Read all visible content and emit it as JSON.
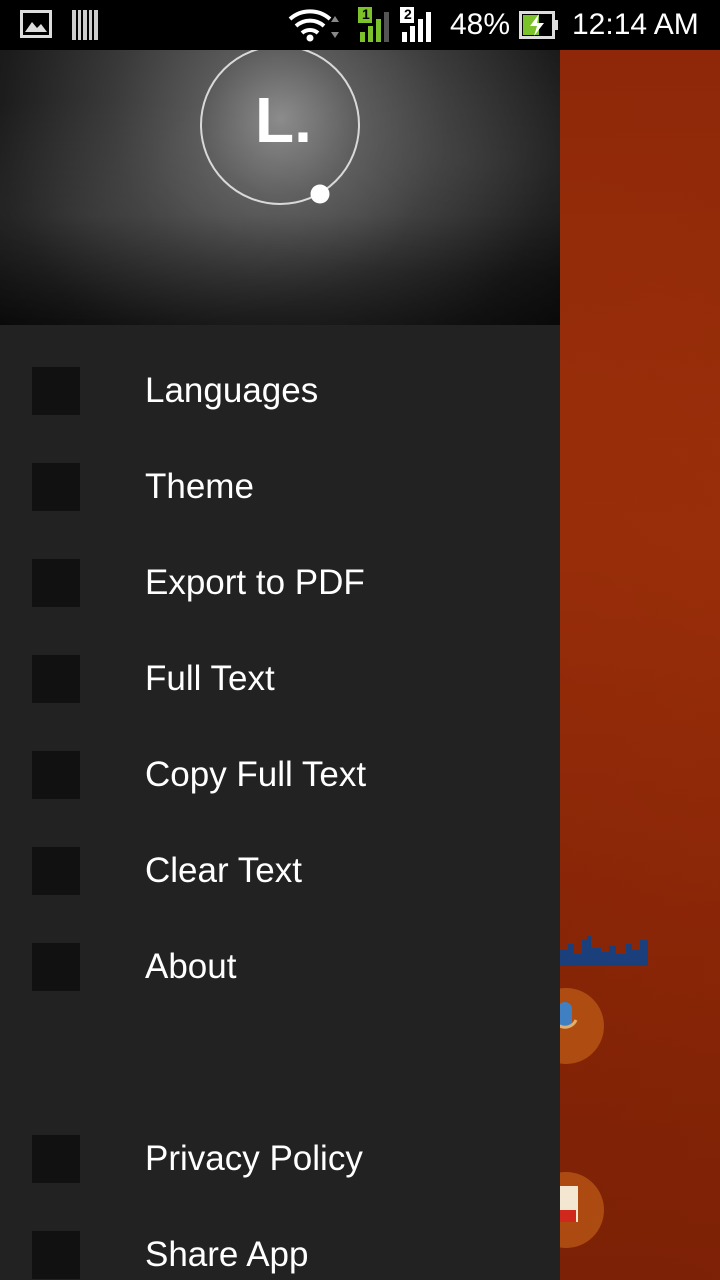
{
  "status_bar": {
    "left_icons": [
      "gallery-icon",
      "barcode-icon"
    ],
    "right_icons": [
      "wifi-icon",
      "sim1-signal-icon",
      "sim2-signal-icon",
      "battery-charging-icon"
    ],
    "sim1_label": "1",
    "sim2_label": "2",
    "battery_percent": "48%",
    "time": "12:14 AM"
  },
  "drawer": {
    "header": {
      "logo_letter": "L."
    },
    "items": [
      {
        "label": "Languages",
        "icon": "languages-icon"
      },
      {
        "label": "Theme",
        "icon": "theme-icon"
      },
      {
        "label": "Export to PDF",
        "icon": "pdf-icon"
      },
      {
        "label": "Full Text",
        "icon": "full-text-icon"
      },
      {
        "label": "Copy Full Text",
        "icon": "copy-icon"
      },
      {
        "label": "Clear Text",
        "icon": "clear-icon"
      },
      {
        "label": "About",
        "icon": "about-icon"
      },
      {
        "label": "Privacy Policy",
        "icon": "privacy-icon"
      },
      {
        "label": "Share App",
        "icon": "share-icon"
      }
    ]
  },
  "colors": {
    "drawer_bg": "#222222",
    "icon_placeholder": "#111111",
    "background_app": "#8a2608",
    "signal_green": "#7cc22b"
  }
}
